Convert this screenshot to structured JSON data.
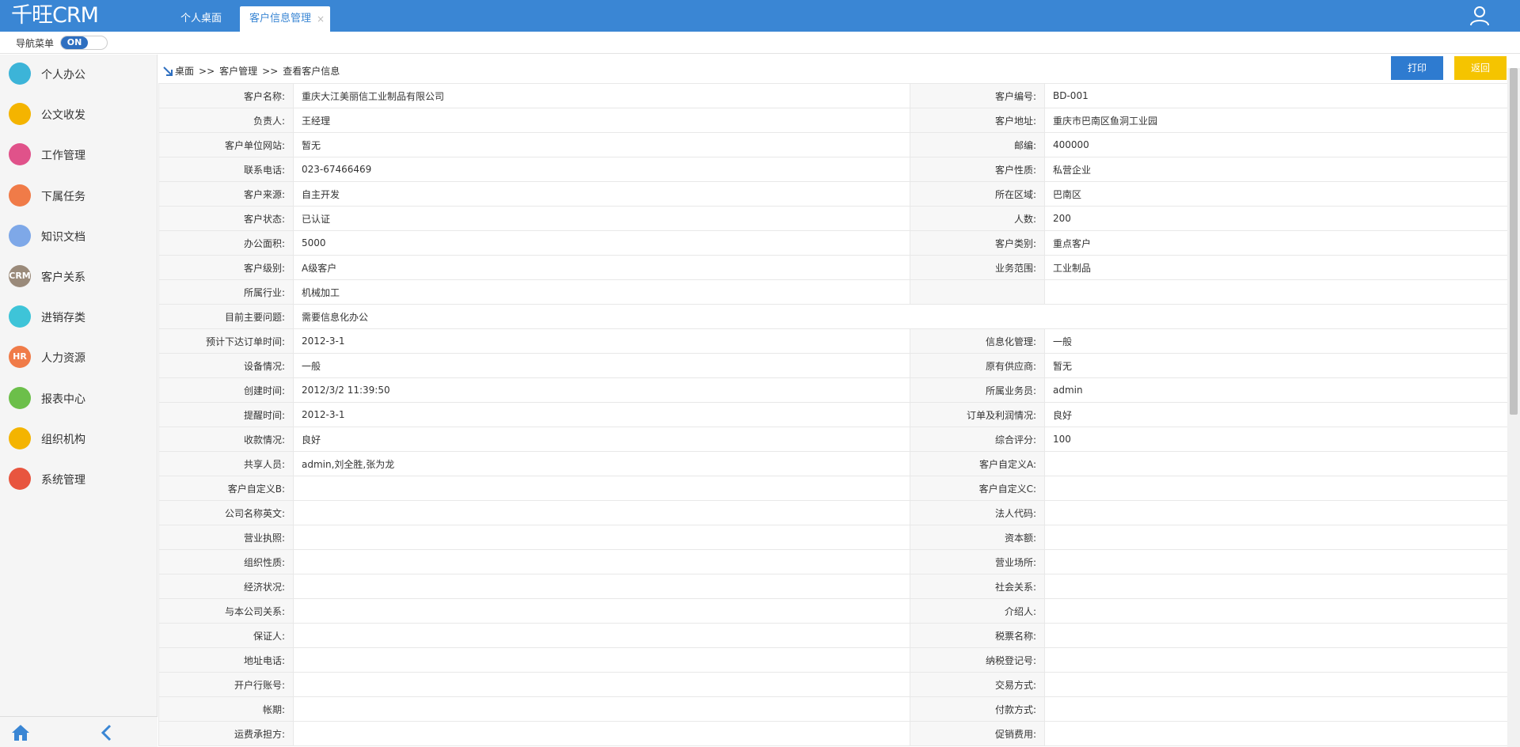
{
  "app": {
    "logo": "千旺CRM"
  },
  "tabs": {
    "home": "个人桌面",
    "active": "客户信息管理",
    "close": "×"
  },
  "nav": {
    "label": "导航菜单",
    "switch": "ON"
  },
  "sidebar": {
    "items": [
      {
        "label": "个人办公",
        "icon": "person-icon",
        "color": "#3cb4d8",
        "glyph": ""
      },
      {
        "label": "公文收发",
        "icon": "document-icon",
        "color": "#f4b400",
        "glyph": ""
      },
      {
        "label": "工作管理",
        "icon": "notepad-icon",
        "color": "#e0528a",
        "glyph": ""
      },
      {
        "label": "下属任务",
        "icon": "team-icon",
        "color": "#f07b48",
        "glyph": ""
      },
      {
        "label": "知识文档",
        "icon": "book-icon",
        "color": "#7ea8e8",
        "glyph": ""
      },
      {
        "label": "客户关系",
        "icon": "crm-icon",
        "color": "#9a8a7a",
        "glyph": "CRM"
      },
      {
        "label": "进销存类",
        "icon": "box-icon",
        "color": "#3ec4d8",
        "glyph": ""
      },
      {
        "label": "人力资源",
        "icon": "hr-icon",
        "color": "#f07b48",
        "glyph": "HR"
      },
      {
        "label": "报表中心",
        "icon": "chart-icon",
        "color": "#6cbf4a",
        "glyph": ""
      },
      {
        "label": "组织机构",
        "icon": "gear-icon",
        "color": "#f4b400",
        "glyph": ""
      },
      {
        "label": "系统管理",
        "icon": "window-icon",
        "color": "#e8553f",
        "glyph": ""
      }
    ]
  },
  "breadcrumb": {
    "home": "桌面",
    "sep": ">>",
    "level1": "客户管理",
    "level2": "查看客户信息"
  },
  "buttons": {
    "print": "打印",
    "back": "返回"
  },
  "rows": [
    [
      "客户名称:",
      "重庆大江美丽信工业制品有限公司",
      "客户编号:",
      "BD-001"
    ],
    [
      "负责人:",
      "王经理",
      "客户地址:",
      "重庆市巴南区鱼洞工业园"
    ],
    [
      "客户单位网站:",
      "暂无",
      "邮编:",
      "400000"
    ],
    [
      "联系电话:",
      "023-67466469",
      "客户性质:",
      "私营企业"
    ],
    [
      "客户来源:",
      "自主开发",
      "所在区域:",
      "巴南区"
    ],
    [
      "客户状态:",
      "已认证",
      "人数:",
      "200"
    ],
    [
      "办公面积:",
      "5000",
      "客户类别:",
      "重点客户"
    ],
    [
      "客户级别:",
      "A级客户",
      "业务范围:",
      "工业制品"
    ],
    [
      "所属行业:",
      "机械加工",
      "",
      ""
    ],
    [
      "目前主要问题:",
      "需要信息化办公"
    ],
    [
      "预计下达订单时间:",
      "2012-3-1",
      "信息化管理:",
      "一般"
    ],
    [
      "设备情况:",
      "一般",
      "原有供应商:",
      "暂无"
    ],
    [
      "创建时间:",
      "2012/3/2 11:39:50",
      "所属业务员:",
      "admin"
    ],
    [
      "提醒时间:",
      "2012-3-1",
      "订单及利润情况:",
      "良好"
    ],
    [
      "收款情况:",
      "良好",
      "综合评分:",
      "100"
    ],
    [
      "共享人员:",
      "admin,刘全胜,张为龙",
      "客户自定义A:",
      ""
    ],
    [
      "客户自定义B:",
      "",
      "客户自定义C:",
      ""
    ],
    [
      "公司名称英文:",
      "",
      "法人代码:",
      ""
    ],
    [
      "营业执照:",
      "",
      "资本额:",
      ""
    ],
    [
      "组织性质:",
      "",
      "营业场所:",
      ""
    ],
    [
      "经济状况:",
      "",
      "社会关系:",
      ""
    ],
    [
      "与本公司关系:",
      "",
      "介绍人:",
      ""
    ],
    [
      "保证人:",
      "",
      "税票名称:",
      ""
    ],
    [
      "地址电话:",
      "",
      "纳税登记号:",
      ""
    ],
    [
      "开户行账号:",
      "",
      "交易方式:",
      ""
    ],
    [
      "帐期:",
      "",
      "付款方式:",
      ""
    ],
    [
      "运费承担方:",
      "",
      "促销费用:",
      ""
    ]
  ]
}
